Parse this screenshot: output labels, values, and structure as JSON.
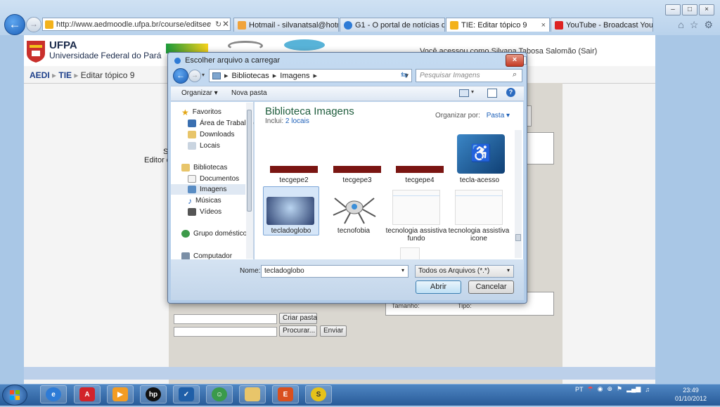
{
  "browser": {
    "address": "http://www.aedmoodle.ufpa.br/course/editsec",
    "tabs": [
      {
        "label": "Hotmail - silvanatsal@hotmail...."
      },
      {
        "label": "G1 - O portal de notícias da Gl..."
      },
      {
        "label": "TIE: Editar tópico 9",
        "close": "×"
      },
      {
        "label": "YouTube - Broadcast Yourself."
      }
    ],
    "win_controls": [
      "–",
      "□",
      "×"
    ]
  },
  "page": {
    "brand_title": "UFPA",
    "brand_subtitle": "Universidade Federal do Pará",
    "welcome": "Você acessou como Silvana Tabosa Salomão (Sair)",
    "breadcrumb": [
      "AEDI",
      "TIE",
      "Editar tópico 9"
    ],
    "side_text_1": "S",
    "side_text_2": "Editor d",
    "create_folder": "Criar pasta",
    "browse": "Procurar...",
    "send": "Enviar",
    "size_label": "Tamanho:",
    "type_label": "Tipo:"
  },
  "dialog": {
    "title": "Escolher arquivo a carregar",
    "close": "×",
    "path": [
      "Bibliotecas",
      "Imagens"
    ],
    "search_placeholder": "Pesquisar Imagens",
    "organize": "Organizar ▾",
    "new_folder": "Nova pasta",
    "nav": {
      "favorites": "Favoritos",
      "fav_items": [
        "Área de Trabalho",
        "Downloads",
        "Locais"
      ],
      "libraries": "Bibliotecas",
      "lib_items": [
        "Documentos",
        "Imagens",
        "Músicas",
        "Vídeos"
      ],
      "homegroup": "Grupo doméstico",
      "computer": "Computador"
    },
    "library_title": "Biblioteca Imagens",
    "includes_label": "Inclui:",
    "includes_value": "2 locais",
    "arrange_label": "Organizar por:",
    "arrange_value": "Pasta ▾",
    "files": [
      {
        "name": "tecgepe2"
      },
      {
        "name": "tecgepe3"
      },
      {
        "name": "tecgepe4"
      },
      {
        "name": "tecla-acesso"
      },
      {
        "name": "tecladoglobo",
        "selected": true
      },
      {
        "name": "tecnofobia"
      },
      {
        "name": "tecnologia assistiva fundo"
      },
      {
        "name": "tecnologia assistiva icone"
      }
    ],
    "filename_label": "Nome:",
    "filename_value": "tecladoglobo",
    "filetype_value": "Todos os Arquivos (*.*)",
    "open": "Abrir",
    "cancel": "Cancelar"
  },
  "taskbar": {
    "lang": "PT",
    "time": "23:49",
    "date": "01/10/2012",
    "apps": [
      "internet-explorer",
      "avira",
      "media-player",
      "hp",
      "task",
      "people",
      "explorer",
      "office",
      "mediator"
    ]
  },
  "colors": {
    "accent": "#1c5fb8",
    "library_title": "#1e5c3c",
    "taskbar": "#285b98"
  }
}
